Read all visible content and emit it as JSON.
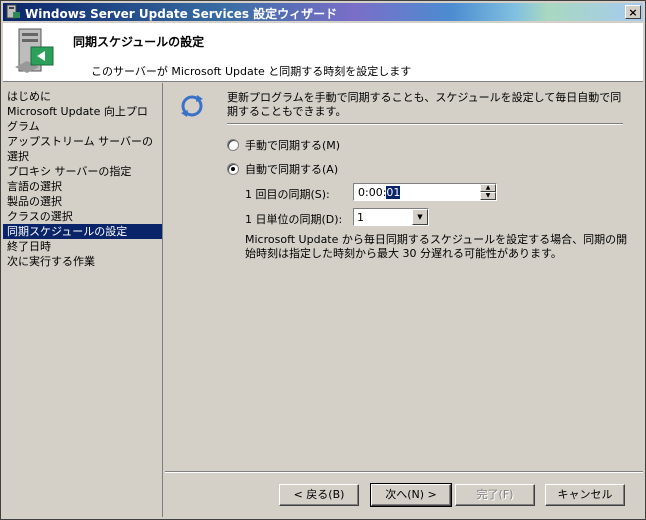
{
  "window": {
    "title": "Windows Server Update Services 設定ウィザード",
    "close_label": "×"
  },
  "header": {
    "title": "同期スケジュールの設定",
    "subtitle": "このサーバーが Microsoft Update と同期する時刻を設定します"
  },
  "nav": {
    "items": [
      {
        "label": "はじめに"
      },
      {
        "label": "Microsoft Update 向上プログラム"
      },
      {
        "label": "アップストリーム サーバーの選択"
      },
      {
        "label": "プロキシ サーバーの指定"
      },
      {
        "label": "言語の選択"
      },
      {
        "label": "製品の選択"
      },
      {
        "label": "クラスの選択"
      },
      {
        "label": "同期スケジュールの設定"
      },
      {
        "label": "終了日時"
      },
      {
        "label": "次に実行する作業"
      }
    ],
    "selected_index": 7
  },
  "content": {
    "description": "更新プログラムを手動で同期することも、スケジュールを設定して毎日自動で同期することもできます。",
    "manual_label": "手動で同期する(M)",
    "auto_label": "自動で同期する(A)",
    "first_sync_label": "1 回目の同期(S):",
    "first_sync_value_prefix": "0:00:",
    "first_sync_value_selected": "01",
    "per_day_label": "1 日単位の同期(D):",
    "per_day_value": "1",
    "note": "Microsoft Update から毎日同期するスケジュールを設定する場合、同期の開始時刻は指定した時刻から最大 30 分遅れる可能性があります。"
  },
  "buttons": {
    "back": "< 戻る(B)",
    "next": "次へ(N) >",
    "finish": "完了(F)",
    "cancel": "キャンセル"
  }
}
